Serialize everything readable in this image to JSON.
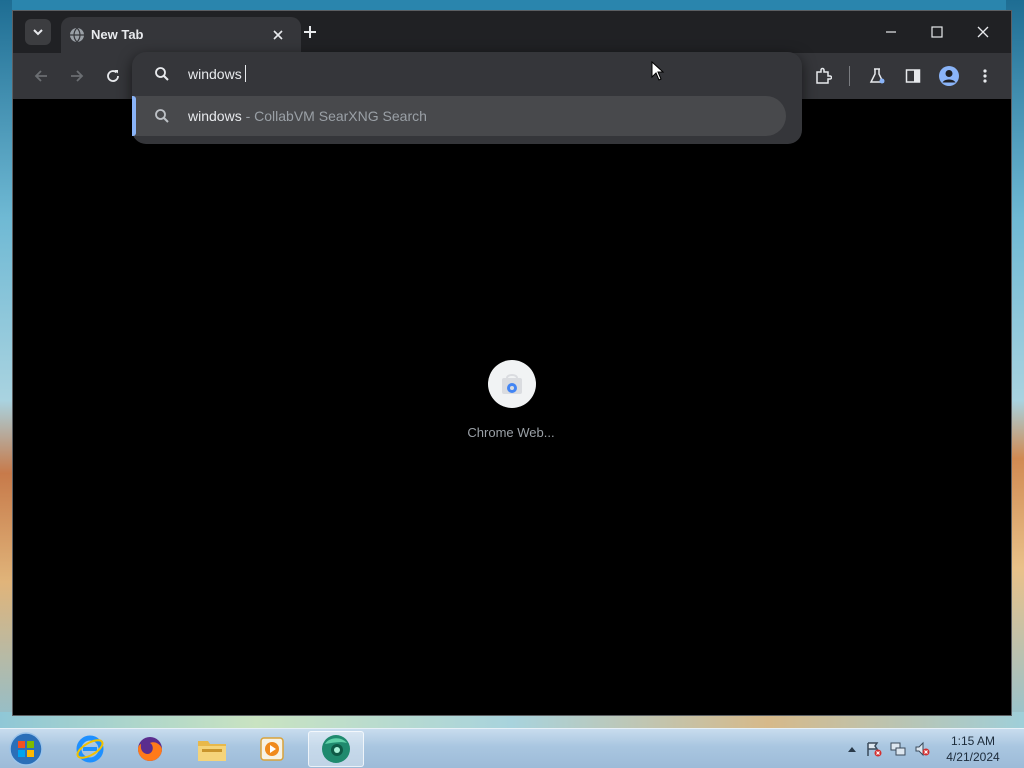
{
  "browser": {
    "tab": {
      "title": "New Tab"
    },
    "omnibox": {
      "query": "windows",
      "suggestion": {
        "query": "windows",
        "separator": " - ",
        "engine": "CollabVM SearXNG Search"
      }
    },
    "shortcuts": [
      {
        "label": "Chrome Web..."
      }
    ],
    "colors": {
      "accent": "#8ab4f8",
      "background": "#000000",
      "toolbar": "#35363a"
    }
  },
  "taskbar": {
    "apps": [
      {
        "name": "internet-explorer-icon"
      },
      {
        "name": "firefox-icon"
      },
      {
        "name": "file-explorer-icon"
      },
      {
        "name": "media-player-icon"
      },
      {
        "name": "chrome-icon",
        "active": true
      }
    ],
    "clock": {
      "time": "1:15 AM",
      "date": "4/21/2024"
    }
  }
}
